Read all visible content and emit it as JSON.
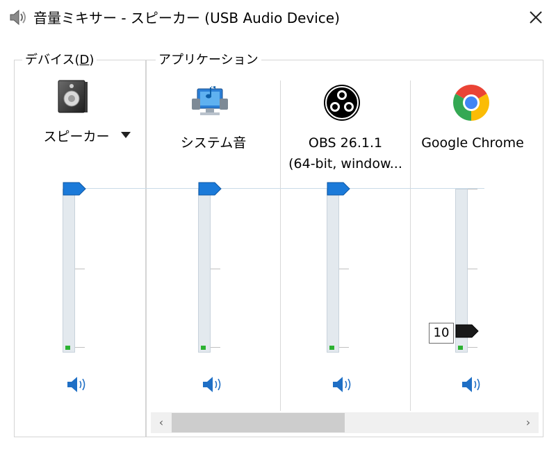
{
  "window": {
    "title": "音量ミキサー - スピーカー (USB Audio Device)",
    "title_icon": "speaker-icon",
    "close_icon": "close-icon"
  },
  "device_group": {
    "label": "デバイス(",
    "mnemonic": "D",
    "label_end": ")",
    "channel": {
      "name": "スピーカー",
      "icon": "speaker-device-icon",
      "dropdown_icon": "dropdown-arrow-icon",
      "volume_percent": 100,
      "mute_icon": "volume-icon"
    }
  },
  "apps_group": {
    "label": "アプリケーション",
    "channels": [
      {
        "name": "システム音",
        "icon": "system-sounds-icon",
        "volume_percent": 100,
        "mute_icon": "volume-icon"
      },
      {
        "name": "OBS 26.1.1",
        "name_line2": "(64-bit, window...",
        "icon": "obs-icon",
        "volume_percent": 100,
        "mute_icon": "volume-icon"
      },
      {
        "name": "Google Chrome",
        "icon": "chrome-icon",
        "volume_percent": 10,
        "value_tooltip": "10",
        "mute_icon": "volume-icon"
      }
    ]
  },
  "scrollbar": {
    "left_arrow": "‹",
    "right_arrow": "›",
    "position_percent": 0
  },
  "colors": {
    "accent_thumb": "#1b7ad9",
    "focused_thumb": "#1a1a1a",
    "peak_green": "#2cb232",
    "volume_icon_blue": "#1f6fc5"
  }
}
